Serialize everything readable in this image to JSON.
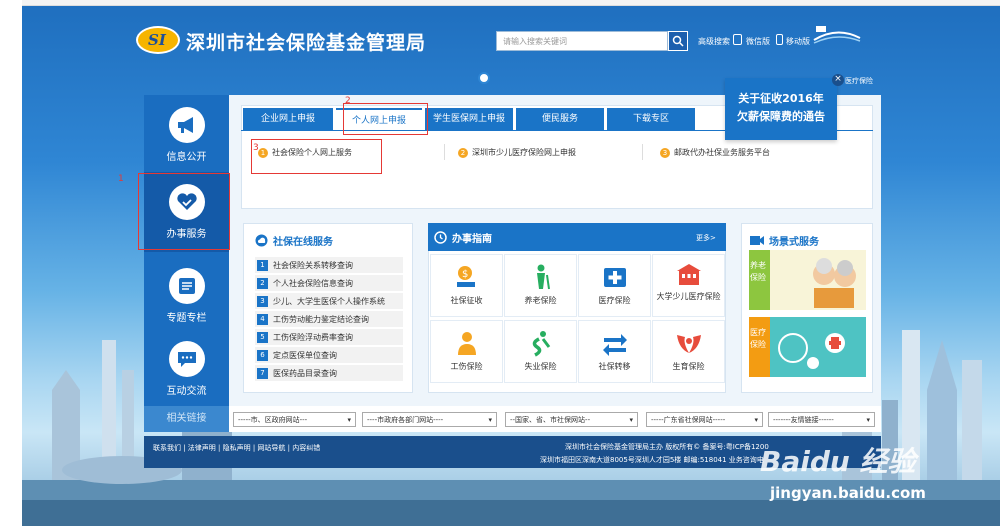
{
  "header": {
    "site_title": "深圳市社会保险基金管理局",
    "logo_text": "SI",
    "search_placeholder": "请输入搜索关键词",
    "links": [
      "高级搜索",
      "微信版",
      "移动版"
    ]
  },
  "notice": {
    "title_line1": "关于征收2016年",
    "title_line2": "欠薪保障费的通告",
    "close": "×",
    "caption": "医疗保险"
  },
  "sidebar": {
    "items": [
      {
        "label": "信息公开",
        "icon": "megaphone-icon"
      },
      {
        "label": "办事服务",
        "icon": "heart-icon"
      },
      {
        "label": "专题专栏",
        "icon": "list-icon"
      },
      {
        "label": "互动交流",
        "icon": "chat-icon"
      }
    ],
    "related": "相关链接"
  },
  "tabs": [
    "企业网上申报",
    "个人网上申报",
    "学生医保网上申报",
    "便民服务",
    "下载专区"
  ],
  "sub_links": [
    {
      "num": "1",
      "label": "社会保险个人网上服务"
    },
    {
      "num": "2",
      "label": "深圳市少儿医疗保险网上申报"
    },
    {
      "num": "3",
      "label": "邮政代办社保业务服务平台"
    }
  ],
  "annotations": [
    "1",
    "2",
    "3"
  ],
  "online_services": {
    "title": "社保在线服务",
    "items": [
      {
        "num": "1",
        "label": "社会保险关系转移查询"
      },
      {
        "num": "2",
        "label": "个人社会保险信息查询"
      },
      {
        "num": "3",
        "label": "少儿、大学生医保个人操作系统"
      },
      {
        "num": "4",
        "label": "工伤劳动能力鉴定结论查询"
      },
      {
        "num": "5",
        "label": "工伤保险浮动费率查询"
      },
      {
        "num": "6",
        "label": "定点医保单位查询"
      },
      {
        "num": "7",
        "label": "医保药品目录查询"
      }
    ]
  },
  "guide": {
    "title": "办事指南",
    "more": "更多>",
    "tiles": [
      "社保征收",
      "养老保险",
      "医疗保险",
      "大学少儿医疗保险",
      "工伤保险",
      "失业保险",
      "社保转移",
      "生育保险"
    ]
  },
  "scenes": {
    "title": "场景式服务",
    "items": [
      "养老保险",
      "医疗保险"
    ]
  },
  "dropdowns": [
    "-----市、区政府网站---",
    "----市政府各部门网站----",
    "--国家、省、市社保网站--",
    "-----广东省社保网站-----",
    "-------友情链接------"
  ],
  "footer": {
    "links": "联系我们 | 法律声明 | 隐私声明 | 网站导航 | 内容纠错",
    "line1": "深圳市社会保险基金管理局主办 版权所有© 备案号:粤ICP备1200",
    "line2": "深圳市福田区深南大道8005号深圳人才园5楼 邮编:518041 业务咨询电"
  },
  "watermark": {
    "brand": "Baidu 经验",
    "url": "jingyan.baidu.com"
  },
  "colors": {
    "primary": "#1a74c7",
    "sidebar": "#1a6dc0",
    "accent": "#f5a623",
    "annotation": "#e53935"
  }
}
